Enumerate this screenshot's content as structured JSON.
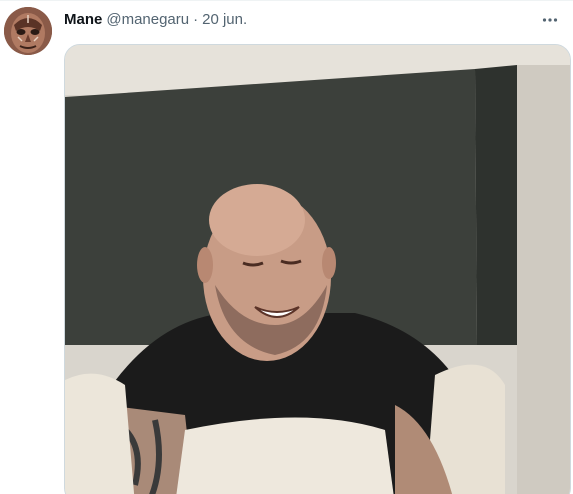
{
  "tweet": {
    "author": {
      "display_name": "Mane",
      "handle": "@manegaru",
      "avatar_icon": "avatar-mask-icon"
    },
    "separator": "·",
    "timestamp": "20 jun.",
    "more_icon": "more-horizontal-icon",
    "media": {
      "type": "video-still",
      "subject_icon": "smiling-bald-man-in-bed"
    }
  },
  "colors": {
    "name_text": "#0f1419",
    "secondary_text": "#536471",
    "border": "#cfd9de",
    "headboard": "#3b3f3a",
    "wall": "#dcd8d0",
    "shirt": "#1a1a1a",
    "skin": "#c79a84",
    "pillow": "#e9e2d6"
  }
}
